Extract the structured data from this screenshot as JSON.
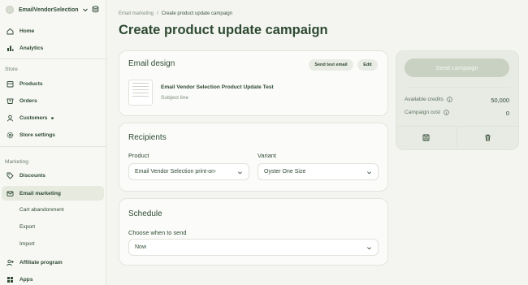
{
  "store": {
    "name": "EmailVendorSelection"
  },
  "sidebar": {
    "items": [
      {
        "label": "Home",
        "icon": "home-icon"
      },
      {
        "label": "Analytics",
        "icon": "bar-chart-icon"
      }
    ],
    "store_section": "Store",
    "store_items": [
      {
        "label": "Products",
        "icon": "box-icon"
      },
      {
        "label": "Orders",
        "icon": "orders-icon"
      },
      {
        "label": "Customers",
        "icon": "person-icon"
      },
      {
        "label": "Store settings",
        "icon": "gear-icon"
      }
    ],
    "marketing_section": "Marketing",
    "marketing_items": [
      {
        "label": "Discounts",
        "icon": "tag-icon"
      },
      {
        "label": "Email marketing",
        "icon": "mail-icon"
      },
      {
        "label": "Cart abandonment"
      },
      {
        "label": "Export"
      },
      {
        "label": "Import"
      },
      {
        "label": "Affiliate program",
        "icon": "person-add-icon"
      },
      {
        "label": "Apps",
        "icon": "apps-icon"
      }
    ]
  },
  "breadcrumb": {
    "parent": "Email marketing",
    "separator": "/",
    "current": "Create product update campaign"
  },
  "page": {
    "title": "Create product update campaign"
  },
  "email_design": {
    "title": "Email design",
    "send_test_label": "Send test email",
    "edit_label": "Edit",
    "email_name": "Email Vendor Selection Product Update Test",
    "subject_label": "Subject line"
  },
  "recipients": {
    "title": "Recipients",
    "product_label": "Product",
    "product_value": "Email Vendor Selection print-on-",
    "variant_label": "Variant",
    "variant_value": "Oyster One Size"
  },
  "schedule": {
    "title": "Schedule",
    "when_label": "Choose when to send",
    "when_value": "Now"
  },
  "summary": {
    "send_label": "Send campaign",
    "credits_label": "Available credits",
    "credits_value": "50,000",
    "cost_label": "Campaign cost",
    "cost_value": "0"
  },
  "colors": {
    "accent": "#2f4a33",
    "background": "#f4f5f1",
    "disabled_button": "#c9d1c3"
  }
}
